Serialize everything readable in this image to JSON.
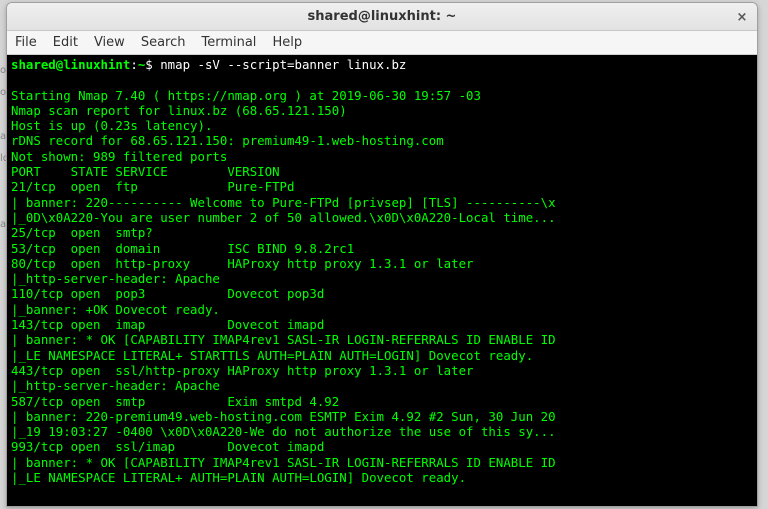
{
  "window": {
    "title": "shared@linuxhint: ~",
    "close_glyph": "×"
  },
  "menu": {
    "file": "File",
    "edit": "Edit",
    "view": "View",
    "search": "Search",
    "terminal": "Terminal",
    "help": "Help"
  },
  "prompt": {
    "user_host": "shared@linuxhint",
    "sep": ":",
    "path": "~",
    "dollar": "$ ",
    "command": "nmap -sV --script=banner linux.bz"
  },
  "output": {
    "l01": "",
    "l02": "Starting Nmap 7.40 ( https://nmap.org ) at 2019-06-30 19:57 -03",
    "l03": "Nmap scan report for linux.bz (68.65.121.150)",
    "l04": "Host is up (0.23s latency).",
    "l05": "rDNS record for 68.65.121.150: premium49-1.web-hosting.com",
    "l06": "Not shown: 989 filtered ports",
    "l07": "PORT    STATE SERVICE        VERSION",
    "l08": "21/tcp  open  ftp            Pure-FTPd",
    "l09": "| banner: 220---------- Welcome to Pure-FTPd [privsep] [TLS] ----------\\x",
    "l10": "|_0D\\x0A220-You are user number 2 of 50 allowed.\\x0D\\x0A220-Local time...",
    "l11": "25/tcp  open  smtp?",
    "l12": "53/tcp  open  domain         ISC BIND 9.8.2rc1",
    "l13": "80/tcp  open  http-proxy     HAProxy http proxy 1.3.1 or later",
    "l14": "|_http-server-header: Apache",
    "l15": "110/tcp open  pop3           Dovecot pop3d",
    "l16": "|_banner: +OK Dovecot ready.",
    "l17": "143/tcp open  imap           Dovecot imapd",
    "l18": "| banner: * OK [CAPABILITY IMAP4rev1 SASL-IR LOGIN-REFERRALS ID ENABLE ID",
    "l19": "|_LE NAMESPACE LITERAL+ STARTTLS AUTH=PLAIN AUTH=LOGIN] Dovecot ready.",
    "l20": "443/tcp open  ssl/http-proxy HAProxy http proxy 1.3.1 or later",
    "l21": "|_http-server-header: Apache",
    "l22": "587/tcp open  smtp           Exim smtpd 4.92",
    "l23": "| banner: 220-premium49.web-hosting.com ESMTP Exim 4.92 #2 Sun, 30 Jun 20",
    "l24": "|_19 19:03:27 -0400 \\x0D\\x0A220-We do not authorize the use of this sy...",
    "l25": "993/tcp open  ssl/imap       Dovecot imapd",
    "l26": "| banner: * OK [CAPABILITY IMAP4rev1 SASL-IR LOGIN-REFERRALS ID ENABLE ID",
    "l27": "|_LE NAMESPACE LITERAL+ AUTH=PLAIN AUTH=LOGIN] Dovecot ready."
  }
}
